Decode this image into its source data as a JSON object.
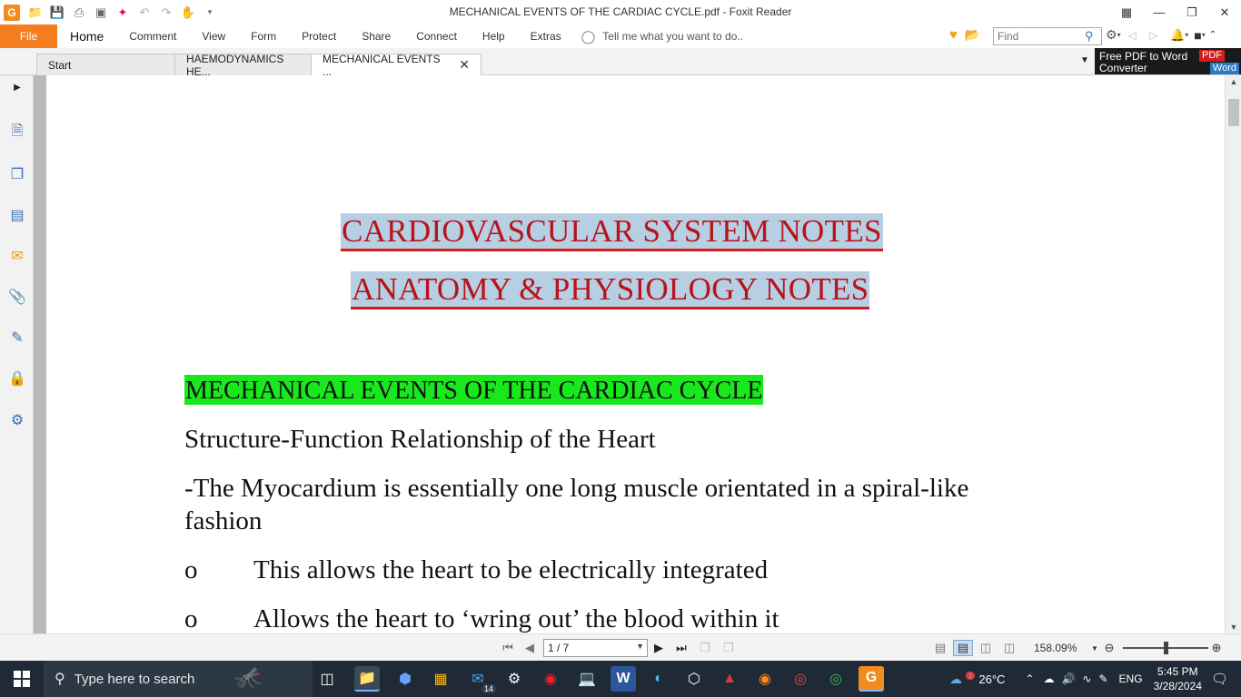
{
  "window": {
    "title": "MECHANICAL EVENTS OF THE CARDIAC CYCLE.pdf - Foxit Reader",
    "app_logo": "G"
  },
  "menu": {
    "file": "File",
    "items": [
      "Home",
      "Comment",
      "View",
      "Form",
      "Protect",
      "Share",
      "Connect",
      "Help",
      "Extras"
    ],
    "tell_me": "Tell me what you want to do..",
    "find_placeholder": "Find"
  },
  "tabs": [
    {
      "label": "Start"
    },
    {
      "label": "HAEMODYNAMICS HE..."
    },
    {
      "label": "MECHANICAL EVENTS ...",
      "active": true
    }
  ],
  "converter": {
    "line1": "Free PDF to Word",
    "line2": "Converter",
    "badge_pdf": "PDF",
    "badge_word": "Word"
  },
  "document": {
    "heading1": "CARDIOVASCULAR SYSTEM NOTES",
    "heading2": "ANATOMY & PHYSIOLOGY NOTES",
    "section_title": "MECHANICAL EVENTS OF THE CARDIAC CYCLE",
    "subtitle": "Structure-Function Relationship of the Heart",
    "para1_line1": "-The Myocardium is essentially one long muscle orientated in a spiral-like",
    "para1_line2": "fashion",
    "bullets": [
      {
        "marker": "o",
        "text": "This allows the heart to be electrically integrated"
      },
      {
        "marker": "o",
        "text": "Allows the heart to ‘wring out’ the blood within it"
      }
    ]
  },
  "navigation": {
    "page_indicator": "1 / 7",
    "zoom": "158.09%",
    "zoom_fraction": 0.51
  },
  "taskbar": {
    "search_placeholder": "Type here to search",
    "mail_badge": "14",
    "weather": "26°C",
    "language": "ENG",
    "time": "5:45 PM",
    "date": "3/28/2024",
    "alert_badge": "1"
  },
  "colors": {
    "file_tab": "#f47d20",
    "heading_red": "#b8121a",
    "heading_highlight": "#b7cfe2",
    "section_highlight": "#19e81e",
    "taskbar": "#1f2a36"
  }
}
